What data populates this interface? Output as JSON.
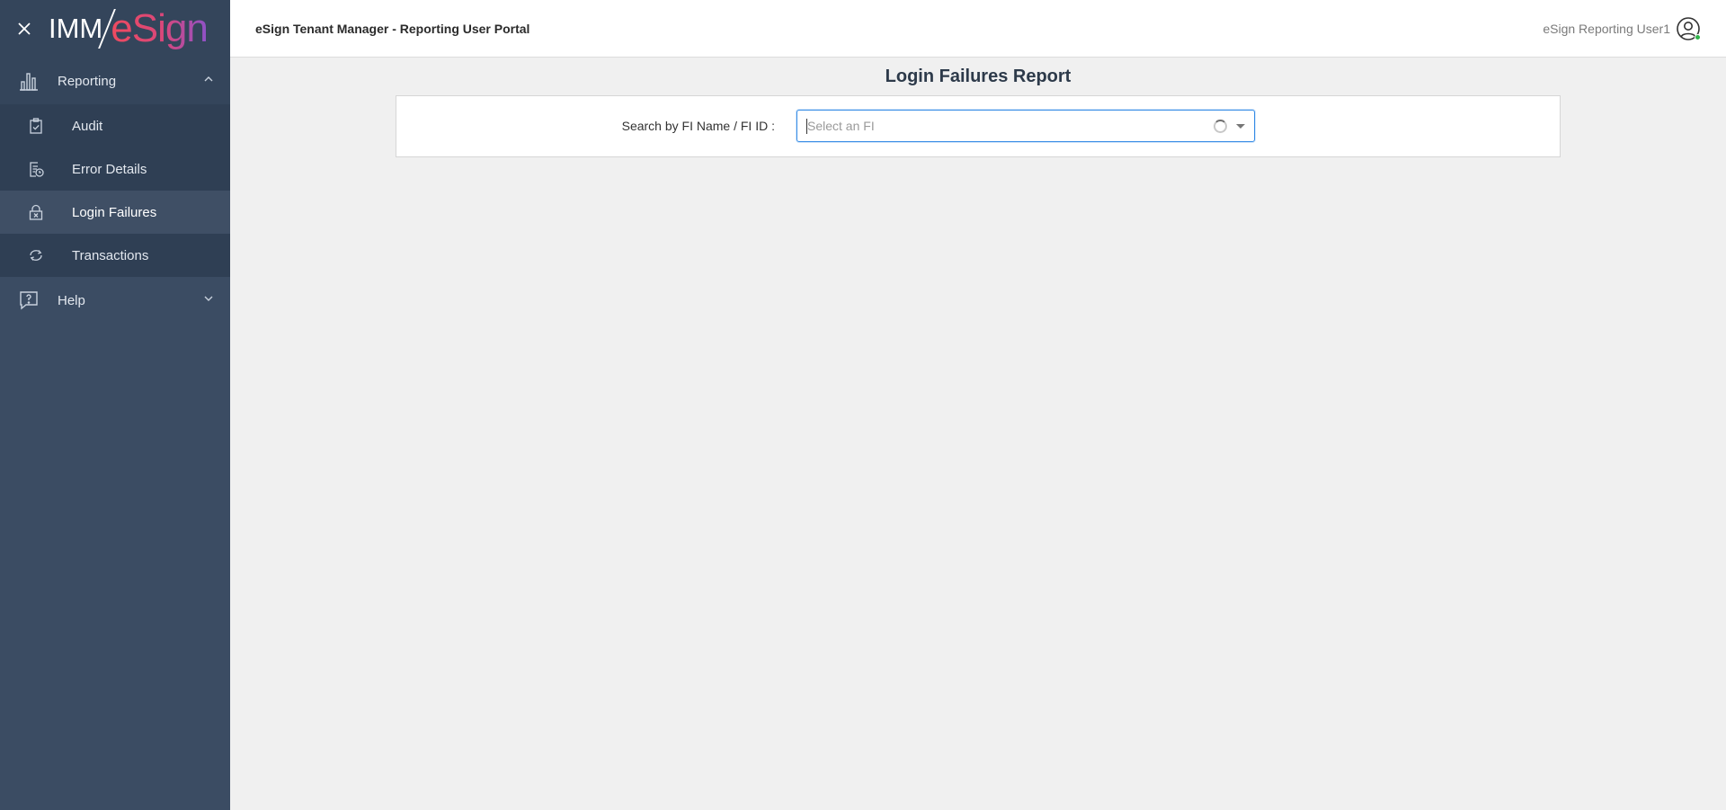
{
  "brand": {
    "logo_left": "IMM",
    "logo_right": "eSign"
  },
  "sidebar": {
    "reporting_label": "Reporting",
    "items": [
      {
        "label": "Audit",
        "icon": "clipboard-check-icon"
      },
      {
        "label": "Error Details",
        "icon": "report-clock-icon"
      },
      {
        "label": "Login Failures",
        "icon": "lock-x-icon",
        "active": true
      },
      {
        "label": "Transactions",
        "icon": "refresh-cycle-icon"
      }
    ],
    "help_label": "Help"
  },
  "header": {
    "title": "eSign Tenant Manager - Reporting User Portal",
    "user_name": "eSign Reporting User1"
  },
  "main": {
    "report_title": "Login Failures Report",
    "search_label": "Search by FI Name / FI ID :",
    "fi_select": {
      "placeholder": "Select an FI",
      "value": ""
    }
  },
  "colors": {
    "sidebar_bg": "#3b4c63",
    "sidebar_active": "#3f4f65",
    "accent_blue": "#3a8ee6",
    "logo_gradient_start": "#ef4b5f",
    "logo_gradient_end": "#8e52c9",
    "online_status": "#2fb34a"
  }
}
